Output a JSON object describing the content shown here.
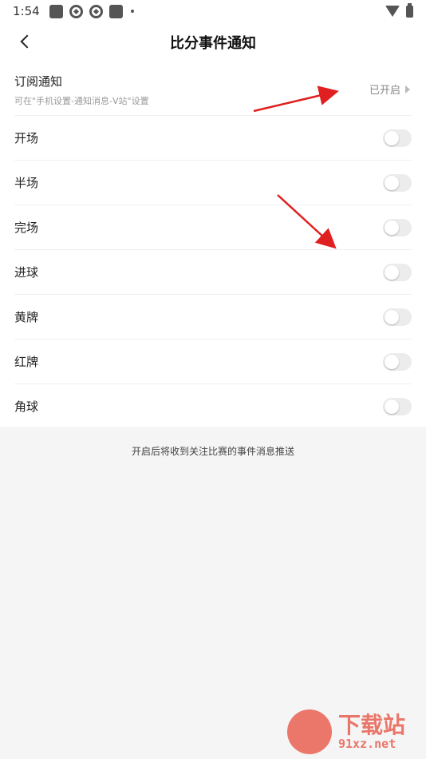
{
  "status_bar": {
    "time": "1:54"
  },
  "nav": {
    "title": "比分事件通知"
  },
  "subscribe": {
    "title": "订阅通知",
    "description": "可在\"手机设置-通知消息-V站\"设置",
    "status": "已开启"
  },
  "events": [
    {
      "label": "开场",
      "enabled": false
    },
    {
      "label": "半场",
      "enabled": false
    },
    {
      "label": "完场",
      "enabled": false
    },
    {
      "label": "进球",
      "enabled": false
    },
    {
      "label": "黄牌",
      "enabled": false
    },
    {
      "label": "红牌",
      "enabled": false
    },
    {
      "label": "角球",
      "enabled": false
    }
  ],
  "footer": {
    "note": "开启后将收到关注比赛的事件消息推送"
  },
  "watermark": {
    "brand": "下载站",
    "site": "91xz.net"
  },
  "colors": {
    "annotation_arrow": "#e02020",
    "toggle_off": "#ececec"
  }
}
